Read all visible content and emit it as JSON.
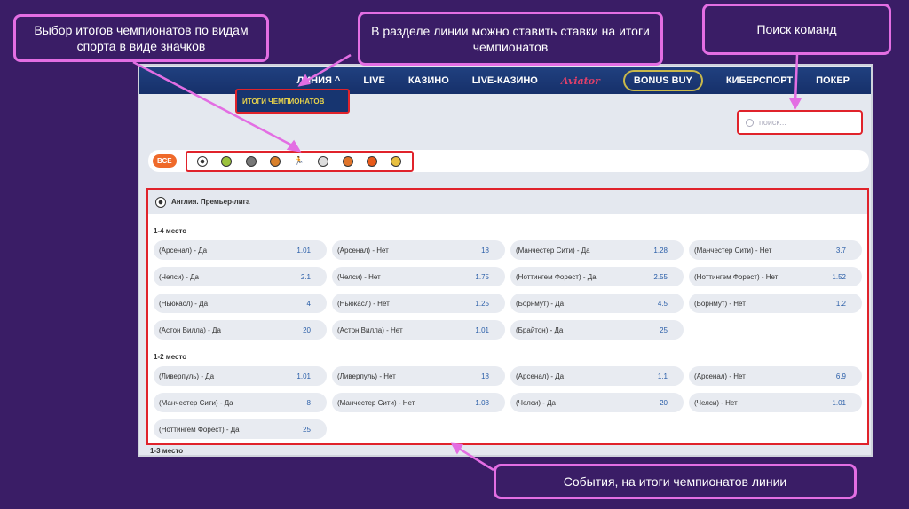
{
  "callouts": {
    "sports_icons": "Выбор итогов чемпионатов по видам спорта в виде значков",
    "line": "В разделе линии можно ставить ставки на итоги чемпионатов",
    "search": "Поиск команд",
    "events": "События, на итоги чемпионатов линии"
  },
  "nav": {
    "items": [
      "ЛИНИЯ ^",
      "LIVE",
      "КАЗИНО",
      "LIVE-КАЗИНО",
      "Aviator",
      "BONUS BUY",
      "КИБЕРСПОРТ",
      "ПОКЕР"
    ],
    "dropdown_item": "ИТОГИ ЧЕМПИОНАТОВ"
  },
  "search": {
    "placeholder": "поиск..."
  },
  "sports": {
    "all_label": "ВСЕ",
    "icons": [
      "soccer",
      "tennis",
      "hockey",
      "basketball",
      "athletics",
      "rugby",
      "volleyball",
      "basketball-orange",
      "handball"
    ]
  },
  "league": {
    "title": "Англия. Премьер-лига"
  },
  "sections": [
    {
      "title": "1-4 место",
      "cells": [
        [
          "(Арсенал) - Да",
          "1.01"
        ],
        [
          "(Арсенал) - Нет",
          "18"
        ],
        [
          "(Манчестер Сити) - Да",
          "1.28"
        ],
        [
          "(Манчестер Сити) - Нет",
          "3.7"
        ],
        [
          "(Челси) - Да",
          "2.1"
        ],
        [
          "(Челси) - Нет",
          "1.75"
        ],
        [
          "(Ноттингем Форест) - Да",
          "2.55"
        ],
        [
          "(Ноттингем Форест) - Нет",
          "1.52"
        ],
        [
          "(Ньюкасл) - Да",
          "4"
        ],
        [
          "(Ньюкасл) - Нет",
          "1.25"
        ],
        [
          "(Борнмут) - Да",
          "4.5"
        ],
        [
          "(Борнмут) - Нет",
          "1.2"
        ],
        [
          "(Астон Вилла) - Да",
          "20"
        ],
        [
          "(Астон Вилла) - Нет",
          "1.01"
        ],
        [
          "(Брайтон) - Да",
          "25"
        ]
      ]
    },
    {
      "title": "1-2 место",
      "cells": [
        [
          "(Ливерпуль) - Да",
          "1.01"
        ],
        [
          "(Ливерпуль) - Нет",
          "18"
        ],
        [
          "(Арсенал) - Да",
          "1.1"
        ],
        [
          "(Арсенал) - Нет",
          "6.9"
        ],
        [
          "(Манчестер Сити) - Да",
          "8"
        ],
        [
          "(Манчестер Сити) - Нет",
          "1.08"
        ],
        [
          "(Челси) - Да",
          "20"
        ],
        [
          "(Челси) - Нет",
          "1.01"
        ],
        [
          "(Ноттингем Форест) - Да",
          "25"
        ]
      ]
    }
  ],
  "next_section": "1-3 место",
  "colors": {
    "background": "#3a1d66",
    "callout_border": "#e36ee3",
    "highlight": "#e0232b",
    "nav": "#1a3775",
    "accent": "#ef6a2a"
  }
}
